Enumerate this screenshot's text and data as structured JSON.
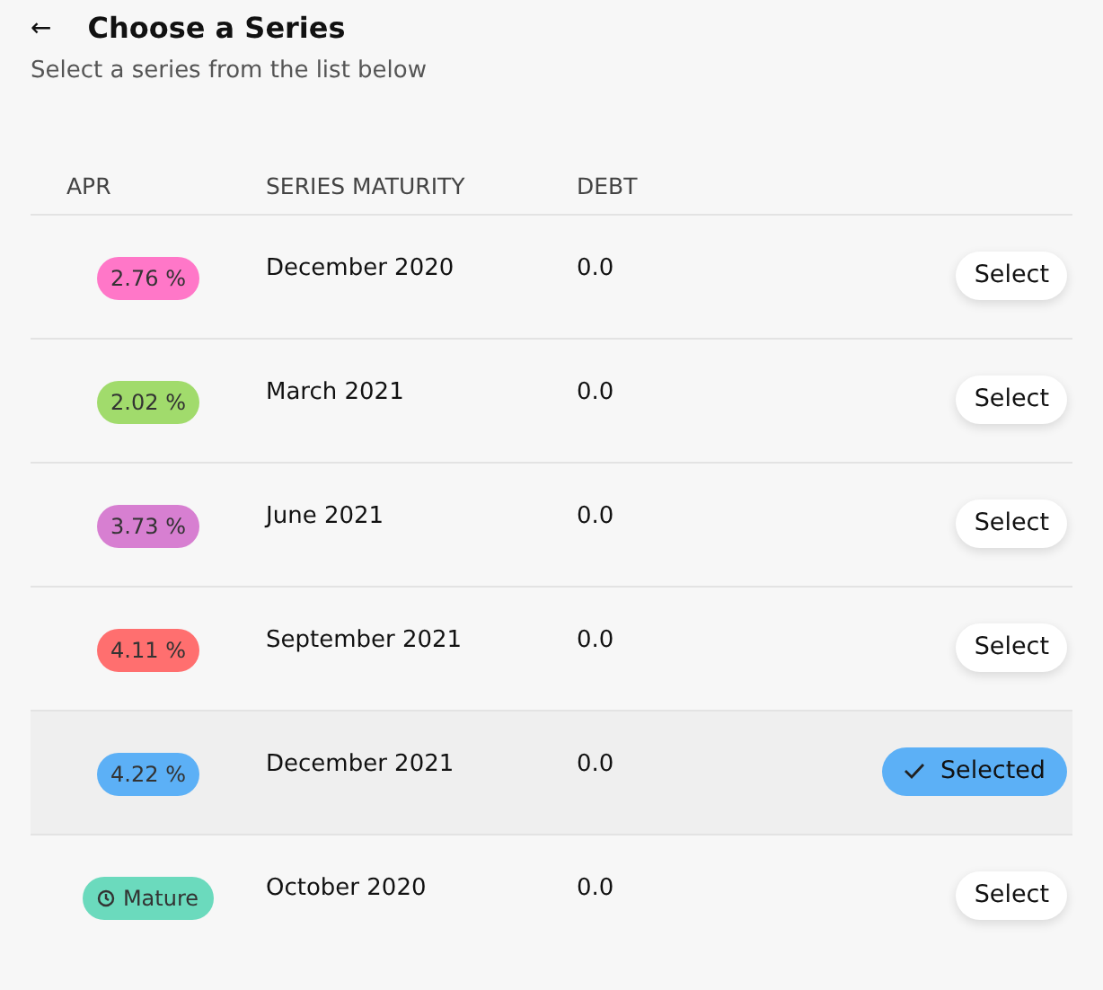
{
  "header": {
    "back": "←",
    "title": "Choose a Series",
    "subtitle": "Select a series from the list below"
  },
  "table": {
    "columns": [
      "APR",
      "SERIES MATURITY",
      "DEBT"
    ],
    "rows": [
      {
        "kind": "rate",
        "apr": "2.76 %",
        "color": "#ff77c8",
        "maturity": "December 2020",
        "debt": "0.0",
        "action": "Select",
        "selected": false
      },
      {
        "kind": "rate",
        "apr": "2.02 %",
        "color": "#a1db6c",
        "maturity": "March 2021",
        "debt": "0.0",
        "action": "Select",
        "selected": false
      },
      {
        "kind": "rate",
        "apr": "3.73 %",
        "color": "#d77fd1",
        "maturity": "June 2021",
        "debt": "0.0",
        "action": "Select",
        "selected": false
      },
      {
        "kind": "rate",
        "apr": "4.11 %",
        "color": "#ff6f6f",
        "maturity": "September 2021",
        "debt": "0.0",
        "action": "Select",
        "selected": false
      },
      {
        "kind": "rate",
        "apr": "4.22 %",
        "color": "#5cb0f6",
        "maturity": "December 2021",
        "debt": "0.0",
        "action": "Selected",
        "selected": true
      },
      {
        "kind": "mature",
        "apr": "Mature",
        "color": "#6bdabd",
        "maturity": "October 2020",
        "debt": "0.0",
        "action": "Select",
        "selected": false
      }
    ]
  }
}
